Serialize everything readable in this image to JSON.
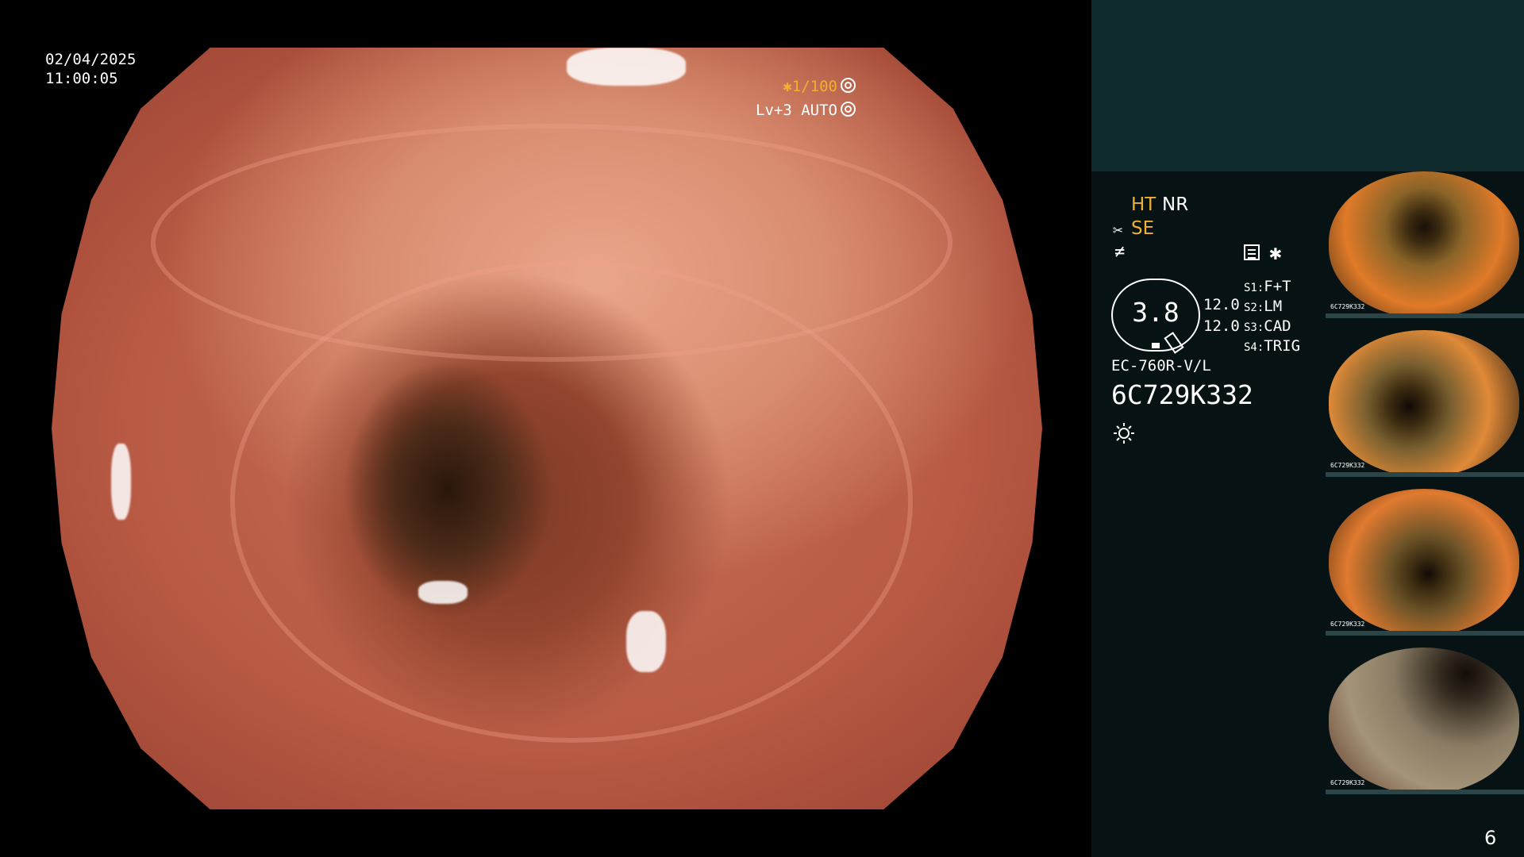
{
  "scope": {
    "date": "02/04/2025",
    "time": "11:00:05",
    "shutter": "✱1/100",
    "level": "Lv+3 AUTO"
  },
  "settings": {
    "ht": "HT",
    "nr": "NR",
    "se": "SE",
    "asterisk": "✱",
    "gauge_value": "3.8",
    "value1": "12.0",
    "value2": "12.0",
    "s_items": [
      {
        "label": "S1:",
        "value": "F+T"
      },
      {
        "label": "S2:",
        "value": "LM"
      },
      {
        "label": "S3:",
        "value": "CAD"
      },
      {
        "label": "S4:",
        "value": "TRIG"
      }
    ],
    "model": "EC-760R-V/L",
    "serial": "6C729K332"
  },
  "thumbnails": [
    {
      "caption": "6C729K332"
    },
    {
      "caption": "6C729K332"
    },
    {
      "caption": "6C729K332"
    },
    {
      "caption": "6C729K332"
    }
  ],
  "page_number": "6",
  "icons": {
    "shutter": "aperture-icon",
    "level": "camera-icon",
    "se": "scissors-icon",
    "enhance": "slash-f-icon",
    "menu": "menu-icon",
    "light": "light-icon"
  },
  "colors": {
    "accent": "#f0b030",
    "panel_top": "#0f2a2c",
    "panel_info": "#071214"
  }
}
